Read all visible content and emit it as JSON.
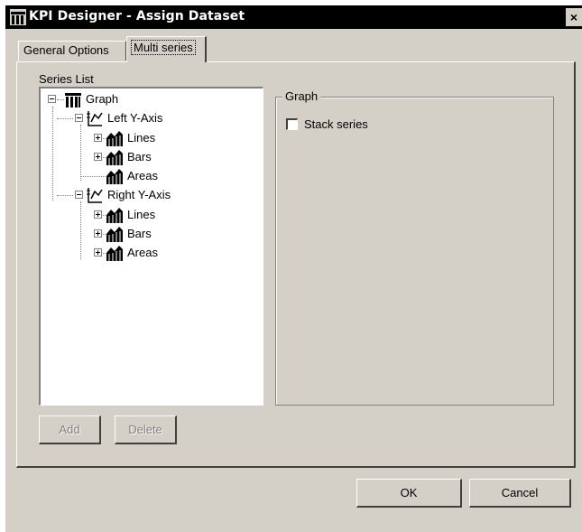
{
  "window": {
    "title": "KPI Designer - Assign Dataset",
    "close_glyph": "×"
  },
  "tabs": [
    {
      "label": "General Options",
      "active": false
    },
    {
      "label": "Multi series",
      "active": true
    }
  ],
  "series_list": {
    "label": "Series List",
    "tree": {
      "root": {
        "label": "Graph",
        "icon": "graph-icon"
      },
      "left_axis": {
        "label": "Left Y-Axis",
        "icon": "axis-icon",
        "children": [
          {
            "label": "Lines"
          },
          {
            "label": "Bars"
          },
          {
            "label": "Areas"
          }
        ]
      },
      "right_axis": {
        "label": "Right Y-Axis",
        "icon": "axis-icon",
        "children": [
          {
            "label": "Lines"
          },
          {
            "label": "Bars"
          },
          {
            "label": "Areas"
          }
        ]
      }
    }
  },
  "graph_group": {
    "title": "Graph",
    "stack_series_label": "Stack series",
    "stack_series_checked": false
  },
  "buttons": {
    "add": "Add",
    "delete": "Delete",
    "ok": "OK",
    "cancel": "Cancel"
  }
}
